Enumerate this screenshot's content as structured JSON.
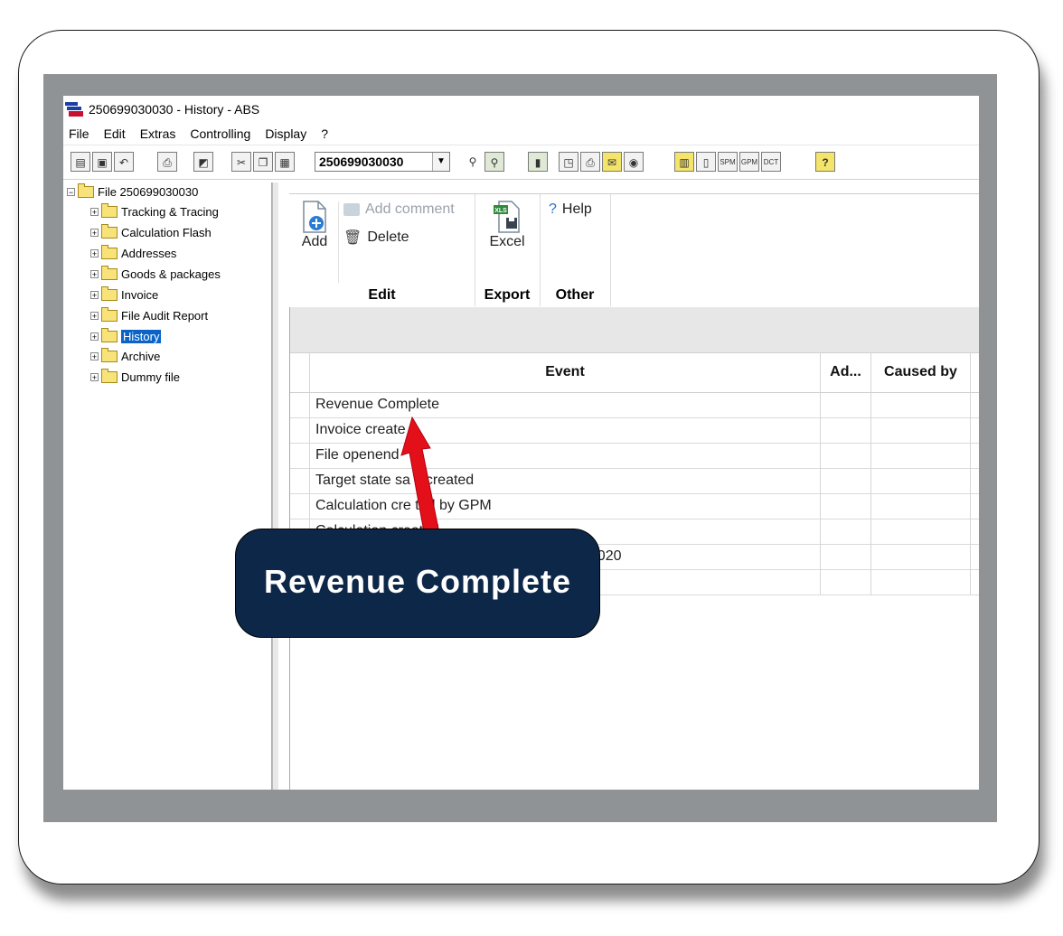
{
  "window": {
    "title": "250699030030 - History - ABS"
  },
  "menubar": {
    "items": [
      "File",
      "Edit",
      "Extras",
      "Controlling",
      "Display",
      "?"
    ]
  },
  "toolbar": {
    "file_number": "250699030030"
  },
  "tree": {
    "root_label": "File 250699030030",
    "items": [
      {
        "label": "Tracking & Tracing"
      },
      {
        "label": "Calculation Flash"
      },
      {
        "label": "Addresses"
      },
      {
        "label": "Goods & packages"
      },
      {
        "label": "Invoice"
      },
      {
        "label": "File Audit Report"
      },
      {
        "label": "History",
        "selected": true
      },
      {
        "label": "Archive"
      },
      {
        "label": "Dummy file"
      }
    ]
  },
  "ribbon": {
    "add_label": "Add",
    "add_comment_label": "Add comment",
    "delete_label": "Delete",
    "excel_label": "Excel",
    "help_label": "Help",
    "edit_group": "Edit",
    "export_group": "Export",
    "other_group": "Other"
  },
  "grid": {
    "columns": [
      "Event",
      "Ad...",
      "Caused by"
    ],
    "rows": [
      {
        "event": "Revenue Complete"
      },
      {
        "event": "Invoice create"
      },
      {
        "event": "File openend"
      },
      {
        "event": "Target state sa  s created"
      },
      {
        "event": "Calculation cre  ted by GPM"
      },
      {
        "event": "Calculation created"
      },
      {
        "event": "30020"
      },
      {
        "event": ""
      }
    ]
  },
  "callout": {
    "text": "Revenue Complete"
  },
  "colors": {
    "callout_bg": "#0c2748",
    "arrow": "#e3101a",
    "selection": "#0a64c8"
  }
}
